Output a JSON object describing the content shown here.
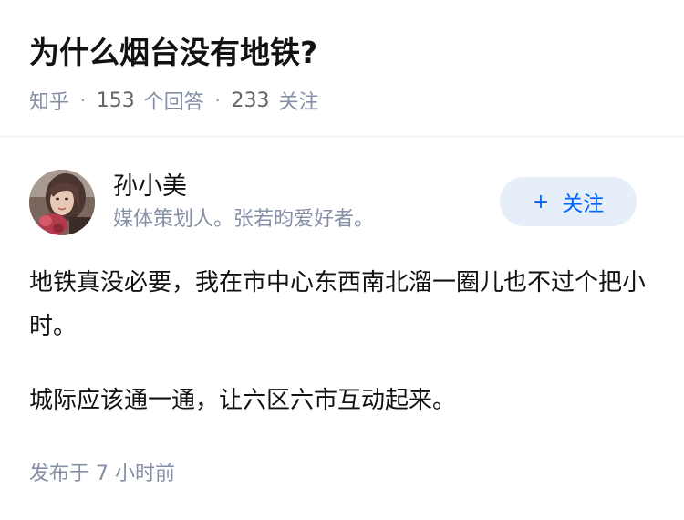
{
  "question": {
    "title": "为什么烟台没有地铁?",
    "source": "知乎",
    "separator": "·",
    "answer_count": "153",
    "answer_label": "个回答",
    "follower_count": "233",
    "follower_label": "关注"
  },
  "author": {
    "name": "孙小美",
    "bio": "媒体策划人。张若昀爱好者。",
    "avatar_icon": "avatar-photo",
    "follow_icon": "+",
    "follow_label": "关注"
  },
  "answer": {
    "paragraphs": [
      "地铁真没必要，我在市中心东西南北溜一圈儿也不过个把小时。",
      "城际应该通一通，让六区六市互动起来。"
    ],
    "published_label": "发布于",
    "published_time": "7 小时前"
  },
  "colors": {
    "accent": "#0066ff",
    "follow_button_bg": "#e6eefa",
    "meta_text": "#8590a6",
    "title_text": "#121212"
  }
}
